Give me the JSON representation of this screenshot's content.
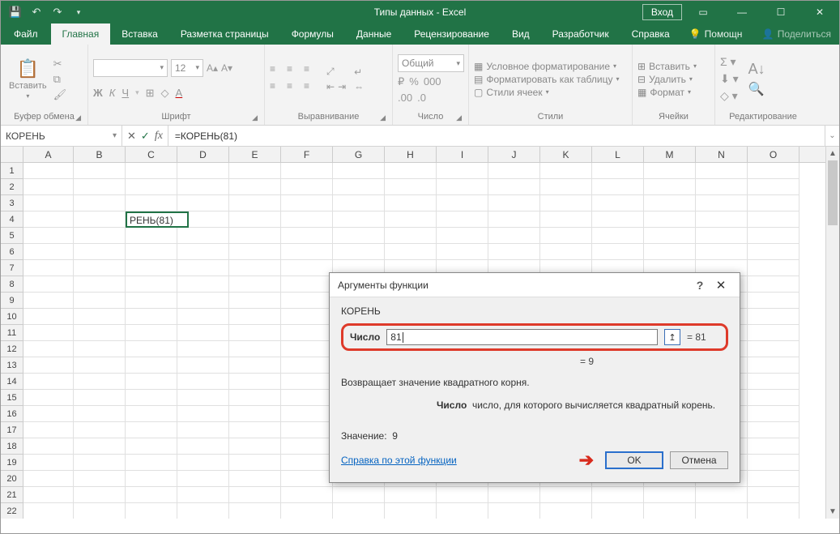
{
  "title": "Типы данных  -  Excel",
  "login": "Вход",
  "tabs": {
    "file": "Файл",
    "home": "Главная",
    "insert": "Вставка",
    "layout": "Разметка страницы",
    "formulas": "Формулы",
    "data": "Данные",
    "review": "Рецензирование",
    "view": "Вид",
    "developer": "Разработчик",
    "help": "Справка",
    "tellme": "Помощн",
    "share": "Поделиться"
  },
  "ribbon": {
    "clipboard": {
      "paste": "Вставить",
      "label": "Буфер обмена"
    },
    "font": {
      "size": "12",
      "label": "Шрифт"
    },
    "align": {
      "label": "Выравнивание"
    },
    "number": {
      "format": "Общий",
      "label": "Число"
    },
    "styles": {
      "cond": "Условное форматирование",
      "table": "Форматировать как таблицу",
      "cell": "Стили ячеек",
      "label": "Стили"
    },
    "cells": {
      "insert": "Вставить",
      "delete": "Удалить",
      "format": "Формат",
      "label": "Ячейки"
    },
    "editing": {
      "label": "Редактирование"
    }
  },
  "fbar": {
    "name": "КОРЕНЬ",
    "formula": "=КОРЕНЬ(81)"
  },
  "columns": [
    "A",
    "B",
    "C",
    "D",
    "E",
    "F",
    "G",
    "H",
    "I",
    "J",
    "K",
    "L",
    "M",
    "N",
    "O"
  ],
  "active_cell_text": "РЕНЬ(81)",
  "dialog": {
    "title": "Аргументы функции",
    "fn": "КОРЕНЬ",
    "arg_label": "Число",
    "arg_value": "81",
    "arg_eval": "= 81",
    "result_eval": "=  9",
    "desc": "Возвращает значение квадратного корня.",
    "arg_desc_label": "Число",
    "arg_desc": "число, для которого вычисляется квадратный корень.",
    "value_label": "Значение:",
    "value": "9",
    "help_link": "Справка по этой функции",
    "ok": "OK",
    "cancel": "Отмена"
  }
}
